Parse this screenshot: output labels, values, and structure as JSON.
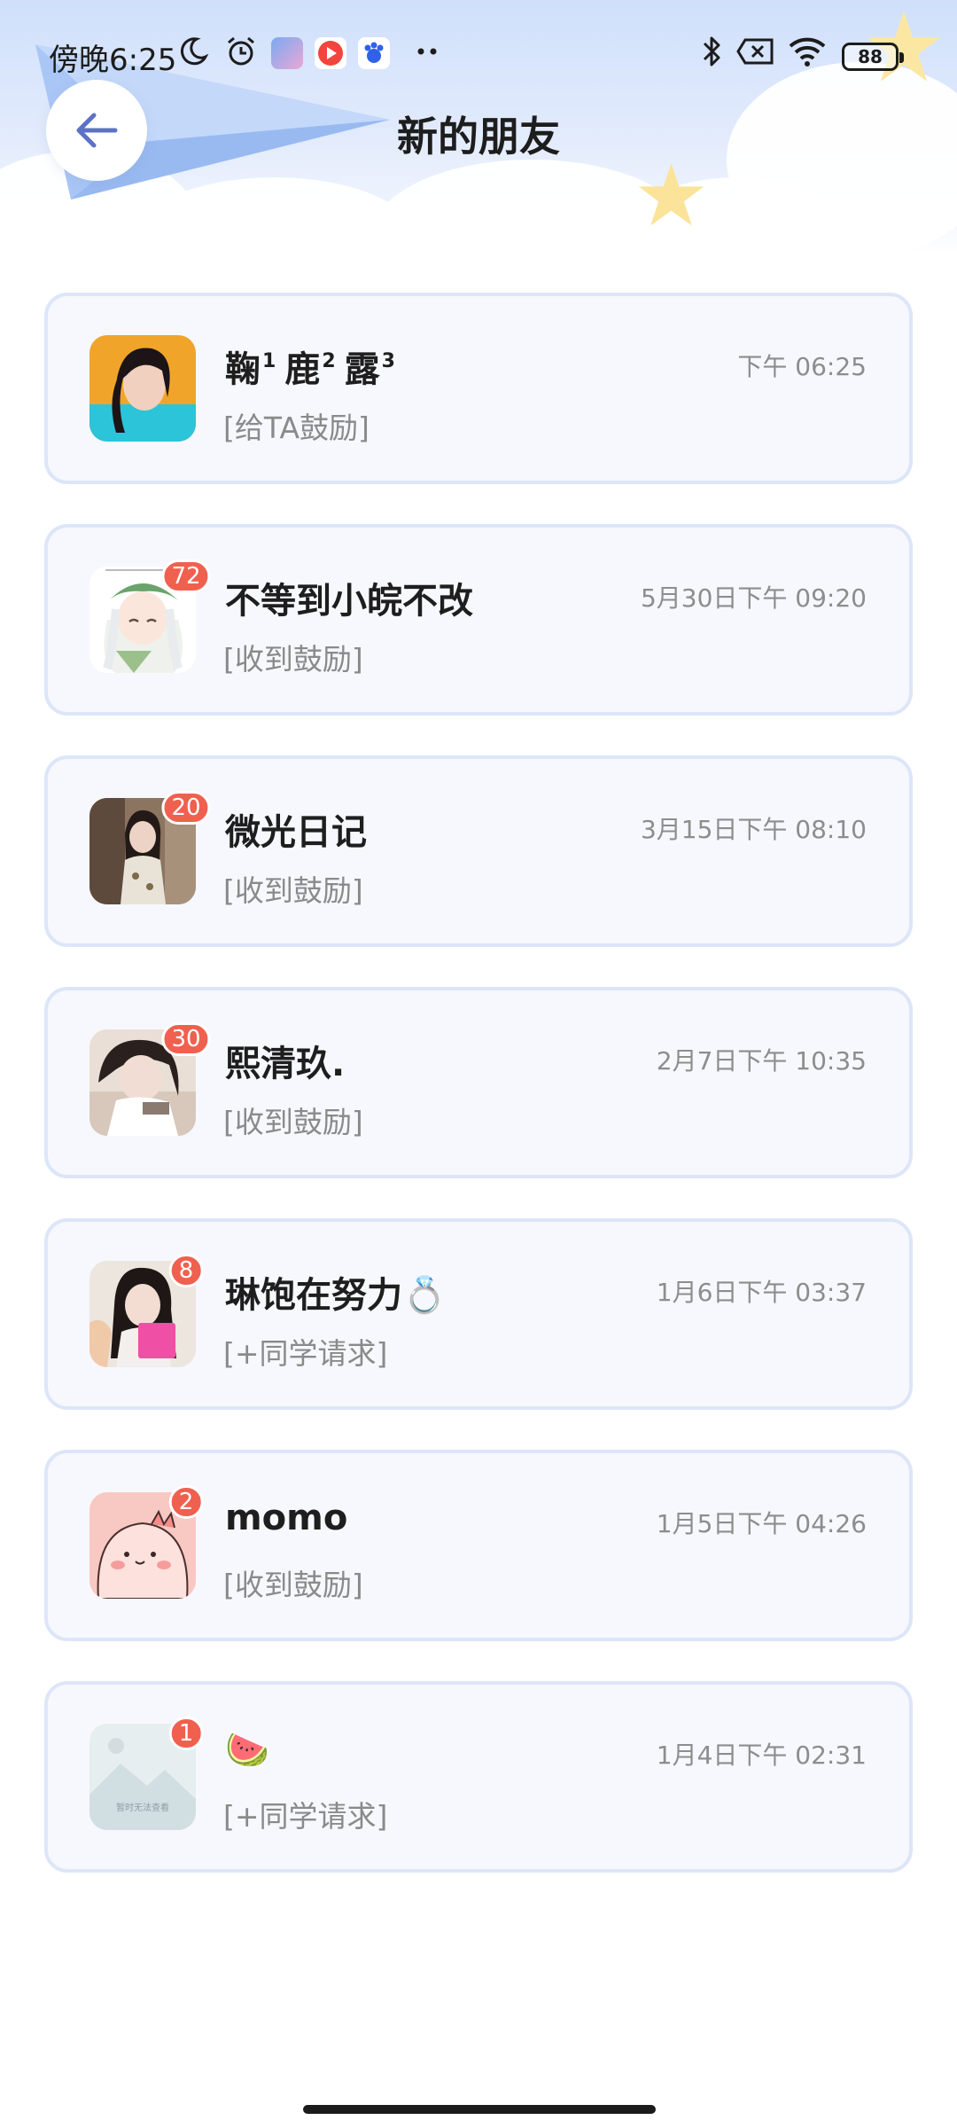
{
  "status_bar": {
    "time": "傍晚6:25",
    "battery": "88"
  },
  "header": {
    "title": "新的朋友"
  },
  "friends": [
    {
      "name_parts": [
        {
          "text": "鞠",
          "sup": "1"
        },
        {
          "text": "鹿",
          "sup": "2"
        },
        {
          "text": "露",
          "sup": "3"
        }
      ],
      "subtext": "[给TA鼓励]",
      "time": "下午 06:25",
      "badge": ""
    },
    {
      "name": "不等到小皖不改",
      "subtext": "[收到鼓励]",
      "time": "5月30日下午 09:20",
      "badge": "72"
    },
    {
      "name": "微光日记",
      "subtext": "[收到鼓励]",
      "time": "3月15日下午 08:10",
      "badge": "20"
    },
    {
      "name": "熙清玖.",
      "subtext": "[收到鼓励]",
      "time": "2月7日下午 10:35",
      "badge": "30"
    },
    {
      "name": "琳饱在努力💍",
      "subtext": "[+同学请求]",
      "time": "1月6日下午 03:37",
      "badge": "8"
    },
    {
      "name": "momo",
      "subtext": "[收到鼓励]",
      "time": "1月5日下午 04:26",
      "badge": "2"
    },
    {
      "name": "🍉",
      "subtext": "[+同学请求]",
      "time": "1月4日下午 02:31",
      "badge": "1",
      "avatar_placeholder_text": "暂时无法查看"
    }
  ]
}
